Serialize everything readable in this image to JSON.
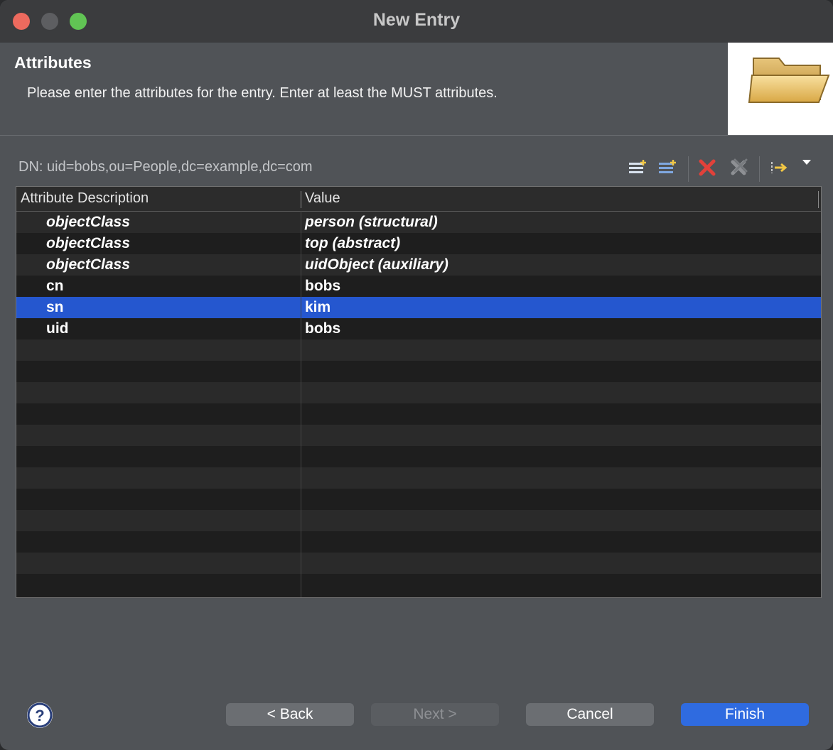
{
  "window": {
    "title": "New Entry"
  },
  "header": {
    "title": "Attributes",
    "description": "Please enter the attributes for the entry. Enter at least the MUST attributes."
  },
  "dn_label": "DN: uid=bobs,ou=People,dc=example,dc=com",
  "toolbar": {
    "icons": [
      "new-attribute-icon",
      "new-value-icon",
      "delete-icon",
      "delete-all-icon",
      "edit-value-icon",
      "menu-dropdown-icon"
    ]
  },
  "table": {
    "columns": [
      "Attribute Description",
      "Value"
    ],
    "rows": [
      {
        "attribute": "objectClass",
        "value": "person (structural)"
      },
      {
        "attribute": "objectClass",
        "value": "top (abstract)"
      },
      {
        "attribute": "objectClass",
        "value": "uidObject (auxiliary)"
      },
      {
        "attribute": "cn",
        "value": "bobs"
      },
      {
        "attribute": "sn",
        "value": "kim"
      },
      {
        "attribute": "uid",
        "value": "bobs"
      }
    ],
    "selected_row": 4
  },
  "buttons": {
    "back": "< Back",
    "next": "Next >",
    "cancel": "Cancel",
    "finish": "Finish"
  },
  "colors": {
    "accent": "#2f6be0",
    "selection": "#2557cf"
  }
}
